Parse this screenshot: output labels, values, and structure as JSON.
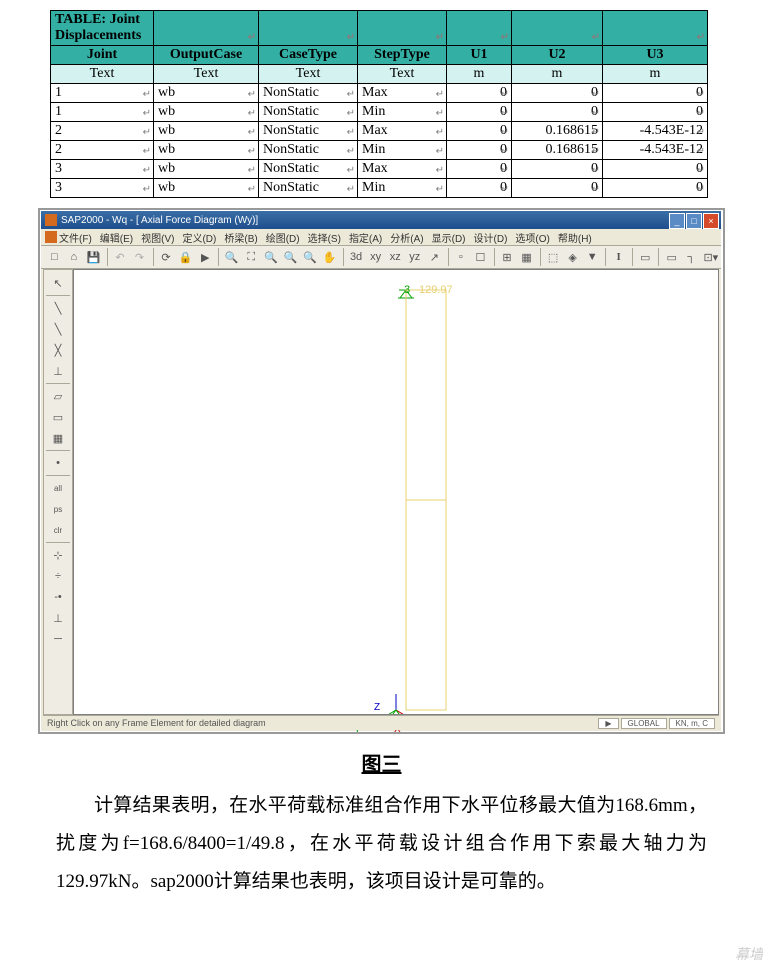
{
  "table": {
    "title": "TABLE:  Joint Displacements",
    "headers": [
      "Joint",
      "OutputCase",
      "CaseType",
      "StepType",
      "U1",
      "U2",
      "U3"
    ],
    "units": [
      "Text",
      "Text",
      "Text",
      "Text",
      "m",
      "m",
      "m"
    ],
    "rows": [
      [
        "1",
        "wb",
        "NonStatic",
        "Max",
        "0",
        "0",
        "0"
      ],
      [
        "1",
        "wb",
        "NonStatic",
        "Min",
        "0",
        "0",
        "0"
      ],
      [
        "2",
        "wb",
        "NonStatic",
        "Max",
        "0",
        "0.168615",
        "-4.543E-12"
      ],
      [
        "2",
        "wb",
        "NonStatic",
        "Min",
        "0",
        "0.168615",
        "-4.543E-12"
      ],
      [
        "3",
        "wb",
        "NonStatic",
        "Max",
        "0",
        "0",
        "0"
      ],
      [
        "3",
        "wb",
        "NonStatic",
        "Min",
        "0",
        "0",
        "0"
      ]
    ]
  },
  "sap": {
    "title": "SAP2000 - Wq - [ Axial Force Diagram   (Wy)]",
    "menus": [
      "文件(F)",
      "编辑(E)",
      "视图(V)",
      "定义(D)",
      "桥梁(B)",
      "绘图(D)",
      "选择(S)",
      "指定(A)",
      "分析(A)",
      "显示(D)",
      "设计(D)",
      "选项(O)",
      "帮助(H)"
    ],
    "status": "Right Click on any Frame Element for detailed diagram",
    "status_r": [
      "GLOBAL",
      "KN, m, C"
    ],
    "node_label": "3",
    "force_label": "129.97",
    "axes": {
      "y": "Y",
      "z": "Z",
      "x": "X"
    }
  },
  "caption": "图三",
  "paragraph": "计算结果表明，在水平荷载标准组合作用下水平位移最大值为168.6mm，扰度为f=168.6/8400=1/49.8，在水平荷载设计组合作用下索最大轴力为129.97kN。sap2000计算结果也表明，该项目设计是可靠的。",
  "watermark": "幕墙"
}
